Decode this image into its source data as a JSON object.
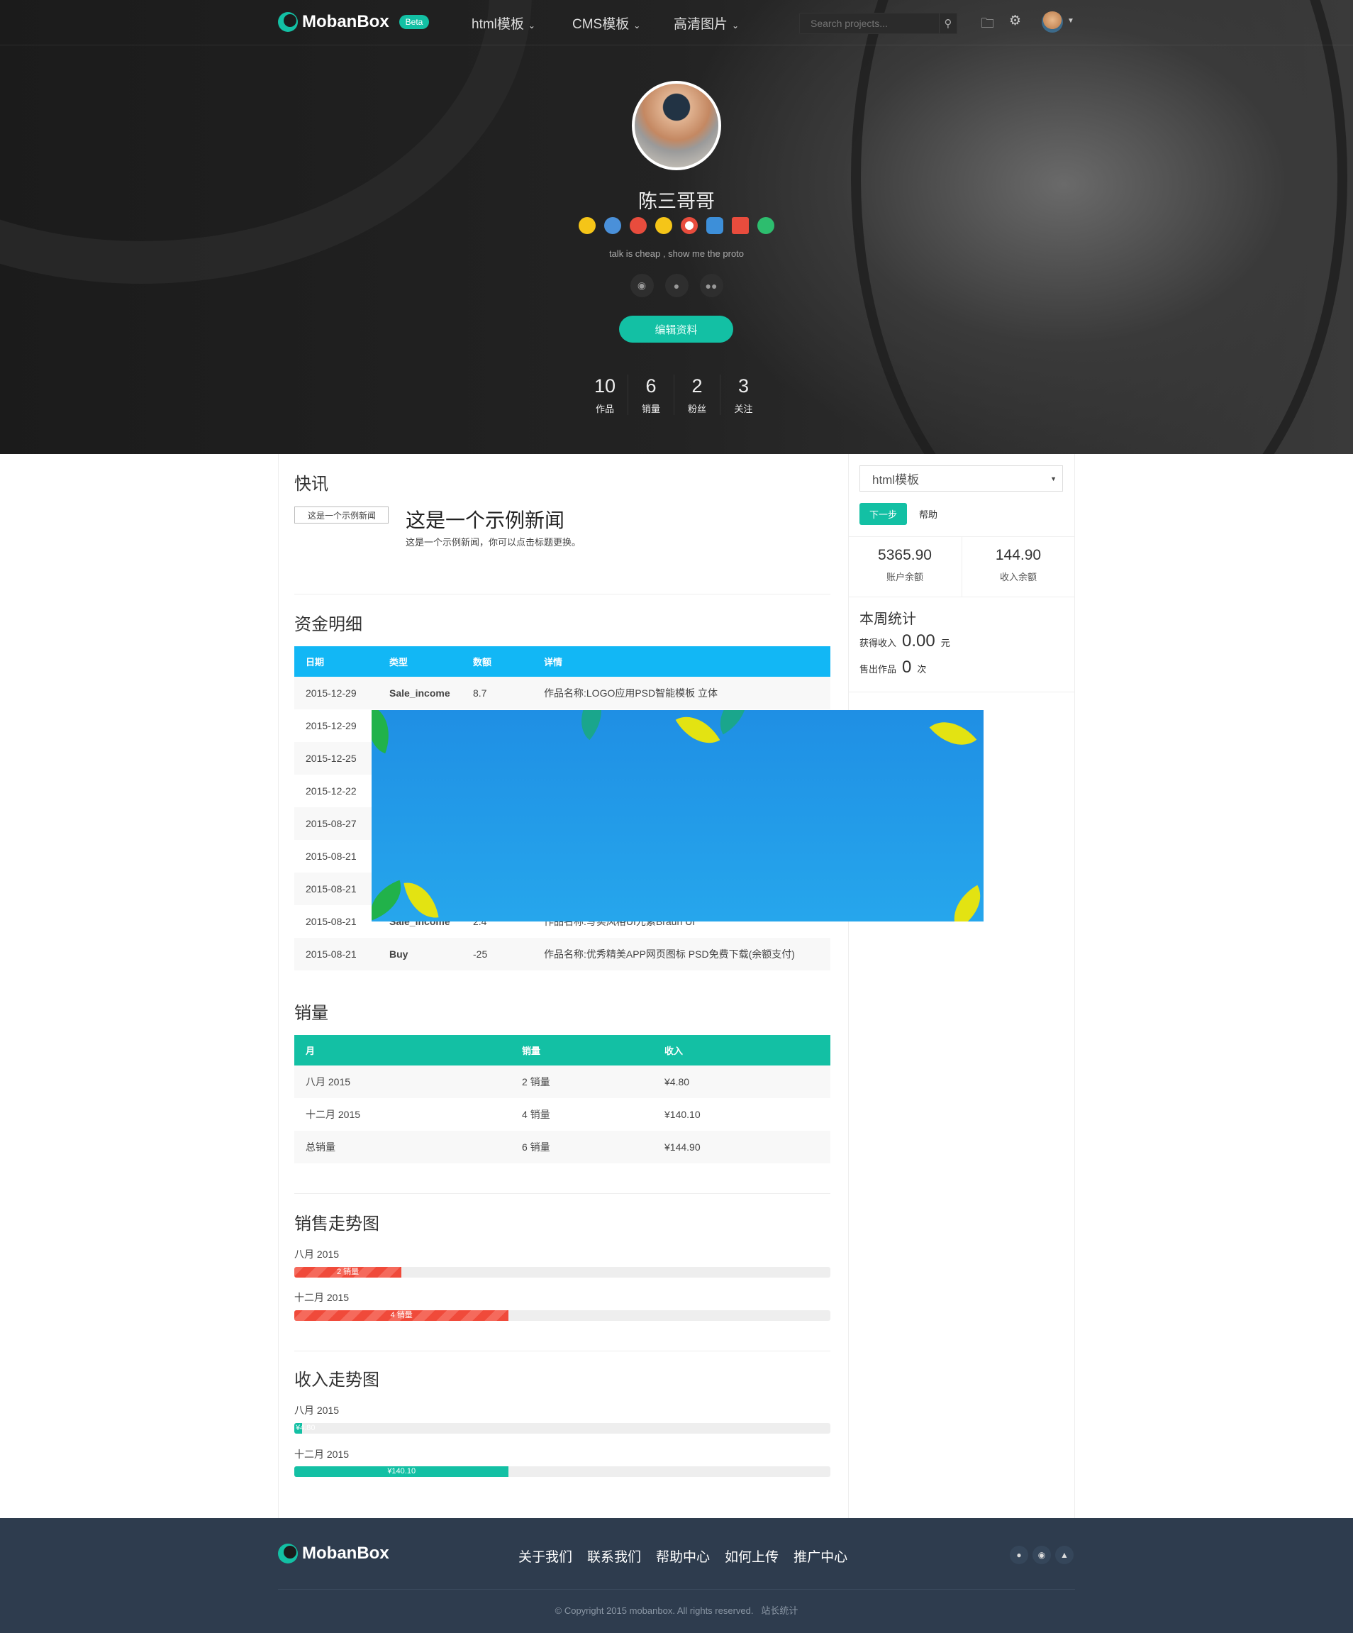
{
  "header": {
    "logo": "MobanBox",
    "beta_badge": "Beta",
    "nav": [
      {
        "label": "html模板"
      },
      {
        "label": "CMS模板"
      },
      {
        "label": "高清图片"
      }
    ],
    "search_placeholder": "Search projects...",
    "icons": [
      "search-icon",
      "folder-icon",
      "gear-icon",
      "avatar",
      "caret-down-icon"
    ]
  },
  "profile": {
    "name": "陈三哥哥",
    "motto": "talk is cheap , show me the proto",
    "badge_colors": [
      "#f5c518",
      "#4a90d9",
      "#e84c3d",
      "#f5c518",
      "#e84c3d",
      "#3d8fd9",
      "#e84c3d",
      "#2dbd6e"
    ],
    "social_icons": [
      "weibo-icon",
      "qq-icon",
      "wechat-icon"
    ],
    "edit_button": "编辑资料",
    "stats": [
      {
        "value": "10",
        "label": "作品"
      },
      {
        "value": "6",
        "label": "销量"
      },
      {
        "value": "2",
        "label": "粉丝"
      },
      {
        "value": "3",
        "label": "关注"
      }
    ]
  },
  "news": {
    "title": "快讯",
    "image_alt": "这是一个示例新闻",
    "headline": "这是一个示例新闻",
    "summary": "这是一个示例新闻，你可以点击标题更换。"
  },
  "funds": {
    "title": "资金明细",
    "header_color": "#12b7f5",
    "columns": [
      "日期",
      "类型",
      "数额",
      "详情"
    ],
    "rows": [
      [
        "2015-12-29",
        "Sale_income",
        "8.7",
        "作品名称:LOGO应用PSD智能模板 立体"
      ],
      [
        "2015-12-29",
        "",
        "",
        ""
      ],
      [
        "2015-12-25",
        "",
        "",
        ""
      ],
      [
        "2015-12-22",
        "",
        "",
        ""
      ],
      [
        "2015-08-27",
        "",
        "",
        ""
      ],
      [
        "2015-08-21",
        "",
        "",
        ""
      ],
      [
        "2015-08-21",
        "",
        "",
        ""
      ],
      [
        "2015-08-21",
        "Sale_income",
        "2.4",
        "作品名称:写实风格UI元素Braun UI"
      ],
      [
        "2015-08-21",
        "Buy",
        "-25",
        "作品名称:优秀精美APP网页图标 PSD免费下载(余额支付)"
      ]
    ]
  },
  "sales": {
    "title": "销量",
    "header_color": "#13c0a4",
    "columns": [
      "月",
      "销量",
      "收入"
    ],
    "rows": [
      [
        "八月 2015",
        "2 销量",
        "¥4.80"
      ],
      [
        "十二月 2015",
        "4 销量",
        "¥140.10"
      ],
      [
        "总销量",
        "6 销量",
        "¥144.90"
      ]
    ]
  },
  "sales_trend": {
    "title": "销售走势图",
    "items": [
      {
        "label": "八月 2015",
        "bar_text": "2 销量",
        "percent": 20
      },
      {
        "label": "十二月 2015",
        "bar_text": "4 销量",
        "percent": 40
      }
    ]
  },
  "income_trend": {
    "title": "收入走势图",
    "items": [
      {
        "label": "八月 2015",
        "bar_text": "¥4.80",
        "percent": 1.4
      },
      {
        "label": "十二月 2015",
        "bar_text": "¥140.10",
        "percent": 40
      }
    ]
  },
  "sidebar": {
    "select_value": "html模板",
    "next_button": "下一步",
    "help_link": "帮助",
    "balances": [
      {
        "value": "5365.90",
        "label": "账户余额"
      },
      {
        "value": "144.90",
        "label": "收入余额"
      }
    ],
    "weekly": {
      "title": "本周统计",
      "income_label": "获得收入",
      "income_value": "0.00",
      "income_unit": "元",
      "sold_label": "售出作品",
      "sold_value": "0",
      "sold_unit": "次"
    }
  },
  "footer": {
    "logo": "MobanBox",
    "links": [
      "关于我们",
      "联系我们",
      "帮助中心",
      "如何上传",
      "推广中心"
    ],
    "social_icons": [
      "wechat-icon",
      "weibo-icon",
      "qq-icon"
    ],
    "copyright": "© Copyright 2015 mobanbox. All rights reserved.",
    "stats_link": "站长统计"
  },
  "colors": {
    "accent": "#13c0a4",
    "footer_bg": "#2e3c4e",
    "progress_red": "#f04a3a"
  }
}
